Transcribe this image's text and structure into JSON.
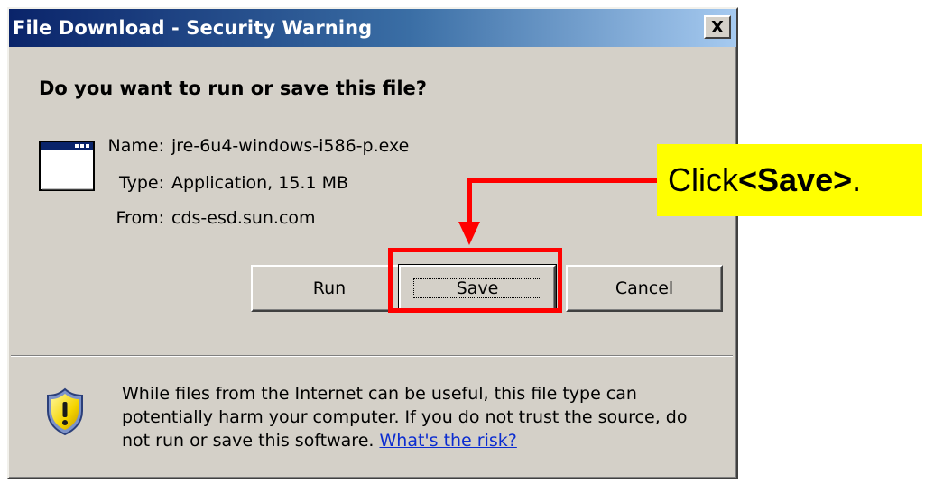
{
  "window": {
    "title": "File Download - Security Warning",
    "close_label": "X"
  },
  "dialog": {
    "heading": "Do you want to run or save this file?",
    "file_icon": "application-window-icon",
    "fields": {
      "name_label": "Name:",
      "name_value": "jre-6u4-windows-i586-p.exe",
      "type_label": "Type:",
      "type_value": "Application, 15.1 MB",
      "from_label": "From:",
      "from_value": "cds-esd.sun.com"
    },
    "buttons": {
      "run": "Run",
      "save": "Save",
      "cancel": "Cancel"
    },
    "warning": {
      "icon": "security-shield-icon",
      "text": "While files from the Internet can be useful, this file type can potentially harm your computer. If you do not trust the source, do not run or save this software.",
      "link": "What's the risk?"
    }
  },
  "annotation": {
    "callout_prefix": "Click ",
    "callout_bold": "<Save>",
    "callout_suffix": ".",
    "callout_color": "#ffff00",
    "highlight_color": "#ff0000"
  },
  "colors": {
    "titlebar_start": "#0a246a",
    "titlebar_end": "#a6caf0",
    "dialog_bg": "#d4d0c8",
    "link": "#0b2cd0"
  }
}
